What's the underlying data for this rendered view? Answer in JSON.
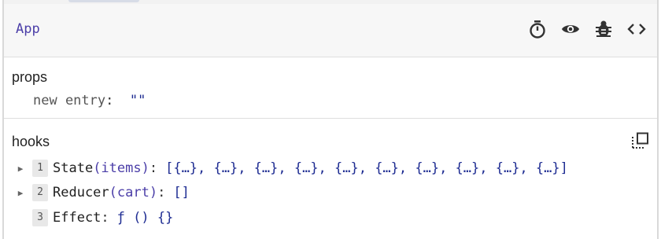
{
  "header": {
    "app_name": "App",
    "icons": [
      "timer-icon",
      "eye-icon",
      "bug-icon",
      "code-icon"
    ]
  },
  "props": {
    "title": "props",
    "items": [
      {
        "key": "new entry",
        "value": "\"\""
      }
    ]
  },
  "hooks": {
    "title": "hooks",
    "copy_icon": "copy-icon",
    "items": [
      {
        "index": "1",
        "name": "State",
        "sub": "(items)",
        "value": "[{…}, {…}, {…}, {…}, {…}, {…}, {…}, {…}, {…}, {…}]",
        "expandable": true
      },
      {
        "index": "2",
        "name": "Reducer",
        "sub": "(cart)",
        "value": "[]",
        "expandable": true
      },
      {
        "index": "3",
        "name": "Effect",
        "sub": "",
        "value": "ƒ () {}",
        "expandable": false
      }
    ]
  },
  "colors": {
    "accent_purple": "#4b3ea8",
    "value_blue": "#1e2c92"
  }
}
